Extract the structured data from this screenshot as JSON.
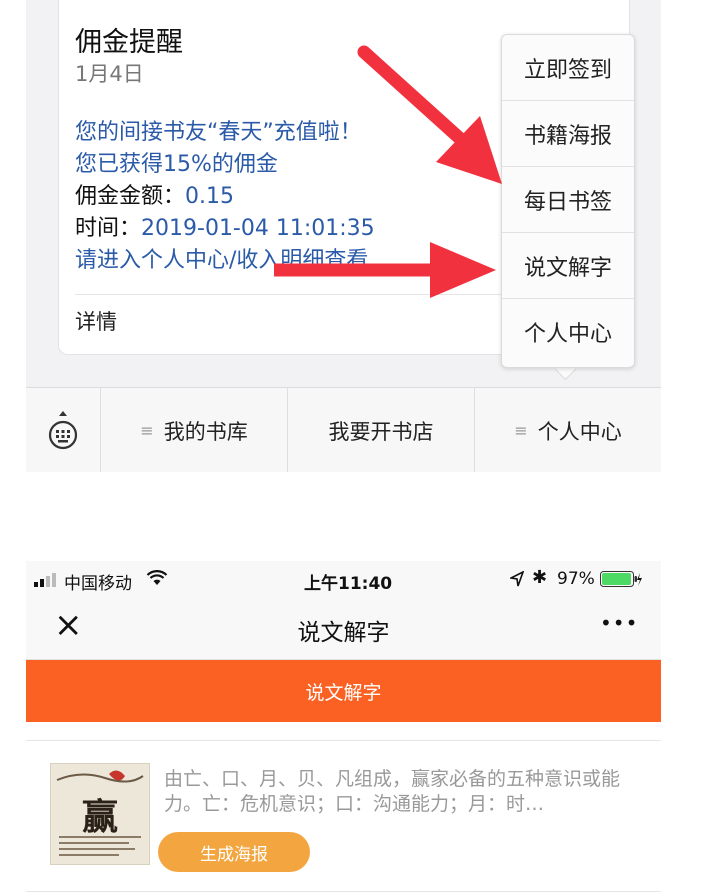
{
  "top": {
    "card": {
      "title": "佣金提醒",
      "date": "1月4日",
      "line1": "您的间接书友“春天”充值啦！",
      "line2": "您已获得15%的佣金",
      "amount_label": "佣金金额：",
      "amount_value": "0.15",
      "time_label": "时间：",
      "time_value": "2019-01-04 11:01:35",
      "line5": "请进入个人中心/收入明细查看",
      "details": "详情"
    },
    "popup_menu": [
      "立即签到",
      "书籍海报",
      "每日书签",
      "说文解字",
      "个人中心"
    ],
    "menu_bar": {
      "item1": "我的书库",
      "item2": "我要开书店",
      "item3": "个人中心"
    }
  },
  "bottom": {
    "status_bar": {
      "carrier": "中国移动",
      "time": "上午11:40",
      "battery": "97%"
    },
    "nav": {
      "close_icon": "×",
      "title": "说文解字",
      "more_icon": "•••"
    },
    "banner": "说文解字",
    "item": {
      "thumb_char": "赢",
      "description": "由亡、口、月、贝、凡组成，赢家必备的五种意识或能力。亡：危机意识；口：沟通能力；月：时…",
      "button": "生成海报"
    }
  },
  "colors": {
    "arrow": "#f2313f",
    "banner": "#fb6122",
    "poster_button": "#f3a640",
    "link_blue": "#2a5aa8",
    "battery_green": "#4cd964"
  }
}
